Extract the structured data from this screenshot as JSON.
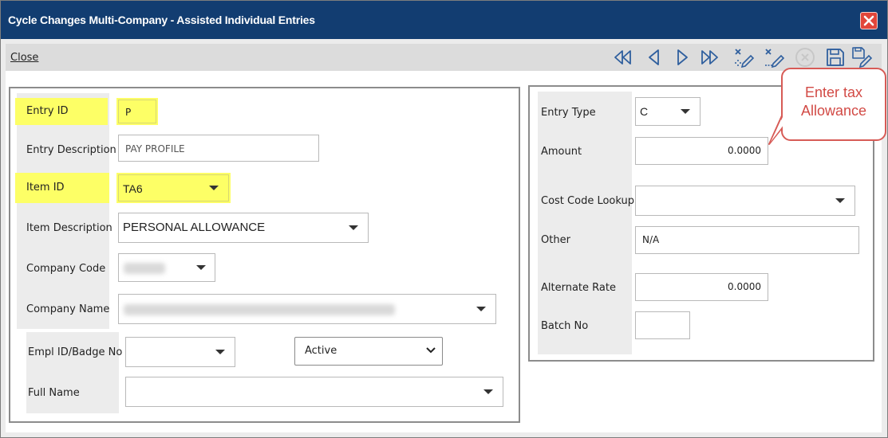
{
  "window": {
    "title": "Cycle Changes Multi-Company - Assisted Individual Entries",
    "close_icon": "close-x-icon"
  },
  "toolbar": {
    "close_label": "Close",
    "buttons": [
      "first-record-icon",
      "previous-record-icon",
      "next-record-icon",
      "last-record-icon",
      "clear-edit-icon",
      "delete-edit-icon",
      "cancel-icon",
      "save-icon",
      "save-edit-icon"
    ]
  },
  "left_form": {
    "entry_id": {
      "label": "Entry ID",
      "value": "P"
    },
    "entry_description": {
      "label": "Entry Description",
      "placeholder": "PAY PROFILE"
    },
    "item_id": {
      "label": "Item ID",
      "value": "TA6"
    },
    "item_description": {
      "label": "Item Description",
      "value": "PERSONAL ALLOWANCE"
    },
    "company_code": {
      "label": "Company Code"
    },
    "company_name": {
      "label": "Company Name"
    },
    "empl_id": {
      "label": "Empl ID/Badge No",
      "value": ""
    },
    "status": {
      "value": "Active"
    },
    "full_name": {
      "label": "Full Name",
      "value": ""
    }
  },
  "right_form": {
    "entry_type": {
      "label": "Entry Type",
      "value": "C"
    },
    "amount": {
      "label": "Amount",
      "value": "0.0000"
    },
    "cost_code_lookup": {
      "label": "Cost Code Lookup",
      "value": ""
    },
    "other": {
      "label": "Other",
      "value": "N/A"
    },
    "alternate_rate": {
      "label": "Alternate Rate",
      "value": "0.0000"
    },
    "batch_no": {
      "label": "Batch No",
      "value": ""
    }
  },
  "callout": {
    "line1": "Enter tax",
    "line2": "Allowance"
  },
  "colors": {
    "titlebar": "#123d71",
    "highlight": "#fdff66",
    "callout": "#d24a45"
  }
}
